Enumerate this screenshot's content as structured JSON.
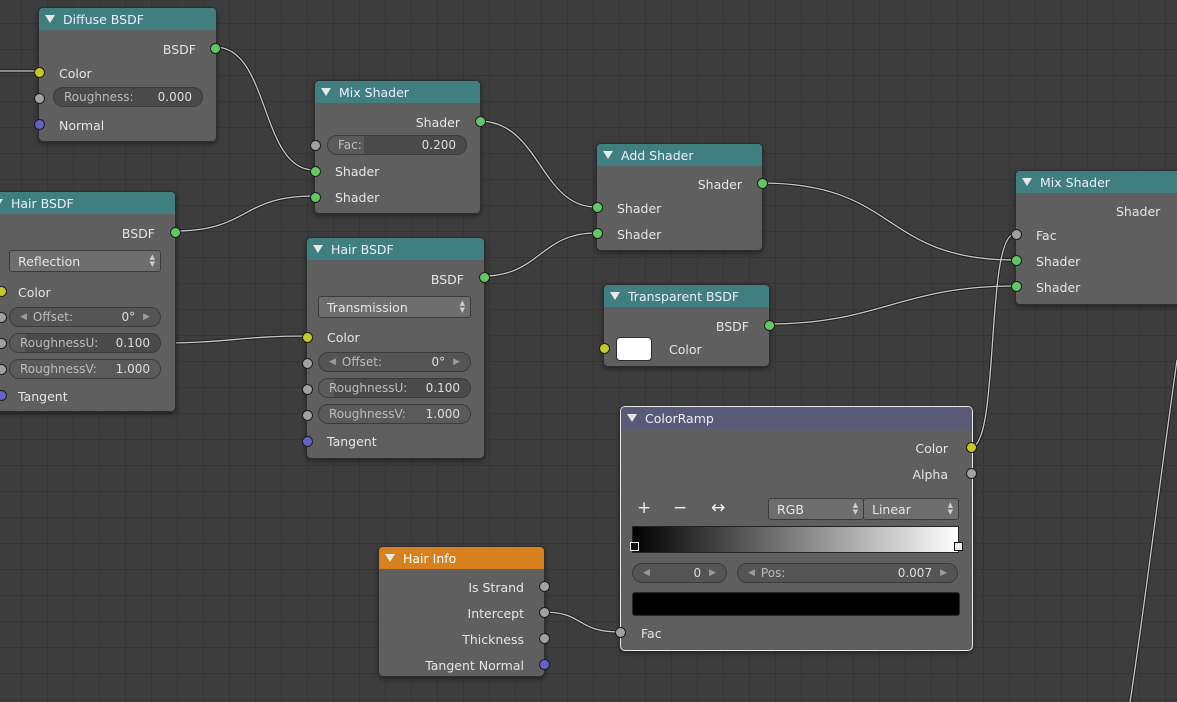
{
  "nodes": {
    "diffuse": {
      "title": "Diffuse BSDF",
      "out": "BSDF",
      "color": "Color",
      "roughness_label": "Roughness:",
      "roughness_value": "0.000",
      "normal": "Normal"
    },
    "mix1": {
      "title": "Mix Shader",
      "out": "Shader",
      "fac_label": "Fac:",
      "fac_value": "0.200",
      "in1": "Shader",
      "in2": "Shader"
    },
    "hair1": {
      "title": "Hair BSDF",
      "out": "BSDF",
      "component": "Reflection",
      "color": "Color",
      "offset_label": "Offset:",
      "offset_value": "0°",
      "ru_label": "RoughnessU:",
      "ru_value": "0.100",
      "rv_label": "RoughnessV:",
      "rv_value": "1.000",
      "tangent": "Tangent"
    },
    "hair2": {
      "title": "Hair BSDF",
      "out": "BSDF",
      "component": "Transmission",
      "color": "Color",
      "offset_label": "Offset:",
      "offset_value": "0°",
      "ru_label": "RoughnessU:",
      "ru_value": "0.100",
      "rv_label": "RoughnessV:",
      "rv_value": "1.000",
      "tangent": "Tangent"
    },
    "add": {
      "title": "Add Shader",
      "out": "Shader",
      "in1": "Shader",
      "in2": "Shader"
    },
    "transparent": {
      "title": "Transparent BSDF",
      "out": "BSDF",
      "color": "Color"
    },
    "mix2": {
      "title": "Mix Shader",
      "out": "Shader",
      "fac": "Fac",
      "in1": "Shader",
      "in2": "Shader"
    },
    "colorramp": {
      "title": "ColorRamp",
      "out_color": "Color",
      "out_alpha": "Alpha",
      "add": "+",
      "remove": "−",
      "flip": "↔",
      "mode": "RGB",
      "interp": "Linear",
      "index_value": "0",
      "pos_label": "Pos:",
      "pos_value": "0.007",
      "fac": "Fac"
    },
    "hairinfo": {
      "title": "Hair Info",
      "is_strand": "Is Strand",
      "intercept": "Intercept",
      "thickness": "Thickness",
      "tangent_normal": "Tangent Normal"
    }
  },
  "values": {
    "diffuse_roughness": 0.0,
    "mix1_fac": 0.2,
    "hair_roughness_u": 0.1,
    "hair_roughness_v": 1.0,
    "colorramp_pos": 0.007
  },
  "colors": {
    "socket_shader": "#63c763",
    "socket_color": "#c7c729",
    "socket_value": "#a1a1a1",
    "socket_vector": "#6363c7",
    "header_shader": "#3f7f7f",
    "header_input": "#d6801e",
    "header_converter": "#5a5a78"
  }
}
